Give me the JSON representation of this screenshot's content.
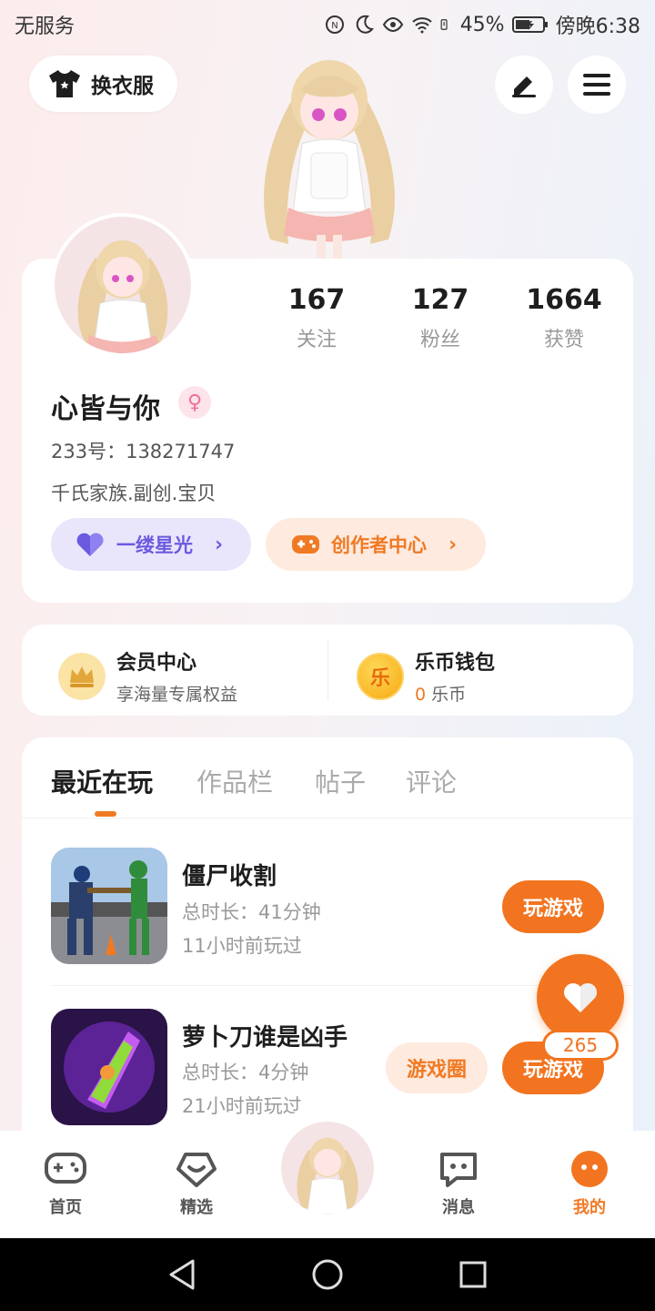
{
  "status_bar": {
    "carrier": "无服务",
    "battery": "45%",
    "time": "傍晚6:38"
  },
  "header": {
    "outfit_label": "换衣服",
    "edit_icon": "edit-icon",
    "menu_icon": "menu-icon"
  },
  "profile": {
    "stats": [
      {
        "value": "167",
        "label": "关注"
      },
      {
        "value": "127",
        "label": "粉丝"
      },
      {
        "value": "1664",
        "label": "获赞"
      }
    ],
    "nickname": "心皆与你",
    "gender_symbol": "♀",
    "id_line": "233号：138271747",
    "bio": "千氏家族.副创.宝贝",
    "star_label": "一缕星光",
    "creator_label": "创作者中心"
  },
  "member": {
    "vip_title": "会员中心",
    "vip_sub": "享海量专属权益",
    "wallet_title": "乐币钱包",
    "wallet_amount": "0",
    "wallet_unit": " 乐币",
    "wallet_icon_char": "乐"
  },
  "tabs": [
    "最近在玩",
    "作品栏",
    "帖子",
    "评论"
  ],
  "games": [
    {
      "title": "僵尸收割",
      "duration": "总时长：41分钟",
      "last_played": "11小时前玩过",
      "play_label": "玩游戏"
    },
    {
      "title": "萝卜刀谁是凶手",
      "duration": "总时长：4分钟",
      "last_played": "21小时前玩过",
      "play_label": "玩游戏",
      "circle_label": "游戏圈"
    }
  ],
  "like_count": "265",
  "bottom_nav": [
    {
      "label": "首页"
    },
    {
      "label": "精选"
    },
    {
      "label": "消息"
    },
    {
      "label": "我的"
    }
  ],
  "colors": {
    "accent": "#f27420",
    "star": "#6a5ae0"
  }
}
